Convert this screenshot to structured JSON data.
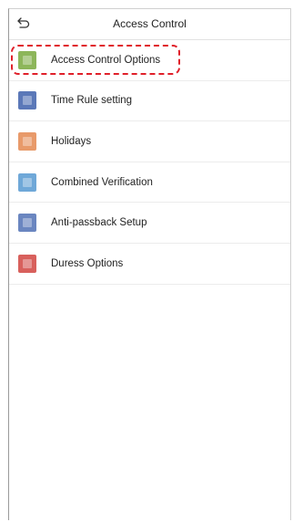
{
  "header": {
    "title": "Access Control",
    "back_icon": "back-arrow-icon"
  },
  "menu": {
    "items": [
      {
        "label": "Access Control Options",
        "icon": "access-control-options-icon",
        "color": "#8db65a"
      },
      {
        "label": "Time Rule setting",
        "icon": "time-rule-icon",
        "color": "#5b78b8"
      },
      {
        "label": "Holidays",
        "icon": "holidays-icon",
        "color": "#e89a6a"
      },
      {
        "label": "Combined Verification",
        "icon": "combined-verification-icon",
        "color": "#6fa8d8"
      },
      {
        "label": "Anti-passback Setup",
        "icon": "anti-passback-icon",
        "color": "#6a86c0"
      },
      {
        "label": "Duress Options",
        "icon": "duress-options-icon",
        "color": "#d8605c"
      }
    ],
    "highlighted_index": 0,
    "highlight_color": "#e0202a"
  }
}
